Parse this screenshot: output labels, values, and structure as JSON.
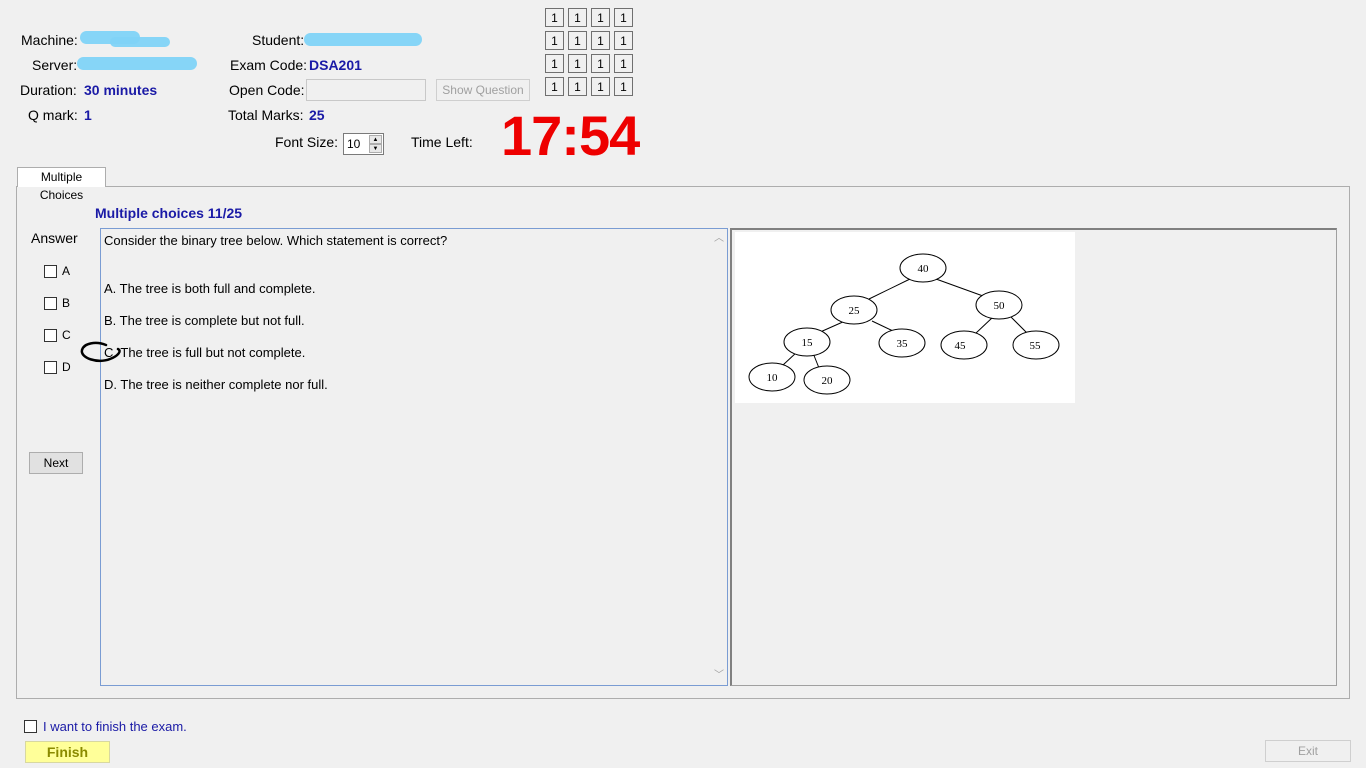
{
  "header": {
    "machine_label": "Machine:",
    "server_label": "Server:",
    "duration_label": "Duration:",
    "duration_value": "30 minutes",
    "qmark_label": "Q mark:",
    "qmark_value": "1",
    "student_label": "Student:",
    "exam_code_label": "Exam Code:",
    "exam_code_value": "DSA201",
    "open_code_label": "Open Code:",
    "open_code_value": "",
    "show_question_label": "Show Question",
    "total_marks_label": "Total Marks:",
    "total_marks_value": "25",
    "font_size_label": "Font Size:",
    "font_size_value": "10",
    "time_left_label": "Time Left:",
    "time_left_value": "17:54"
  },
  "question_grid": [
    [
      "1",
      "1",
      "1",
      "1"
    ],
    [
      "1",
      "1",
      "1",
      "1"
    ],
    [
      "1",
      "1",
      "1",
      "1"
    ],
    [
      "1",
      "1",
      "1",
      "1"
    ]
  ],
  "tabs": [
    {
      "label": "Multiple Choices"
    }
  ],
  "question": {
    "heading": "Multiple choices 11/25",
    "text": "Consider the binary tree below. Which statement is correct?",
    "options": [
      "A.  The tree is both full and complete.",
      "B.  The tree is complete but not full.",
      "C.  The tree is full but not complete.",
      "D.  The tree is neither complete nor full."
    ]
  },
  "answer": {
    "label": "Answer",
    "choices": [
      "A",
      "B",
      "C",
      "D"
    ],
    "next_label": "Next"
  },
  "tree": {
    "nodes": [
      "40",
      "25",
      "50",
      "15",
      "35",
      "45",
      "55",
      "10",
      "20"
    ]
  },
  "footer": {
    "finish_checkbox_label": "I want to finish the exam.",
    "finish_label": "Finish",
    "exit_label": "Exit"
  },
  "colors": {
    "value_blue": "#1a1aa6",
    "timer_red": "#ee0000",
    "finish_yellow": "#ffff99",
    "redaction": "#7fd3f7"
  }
}
